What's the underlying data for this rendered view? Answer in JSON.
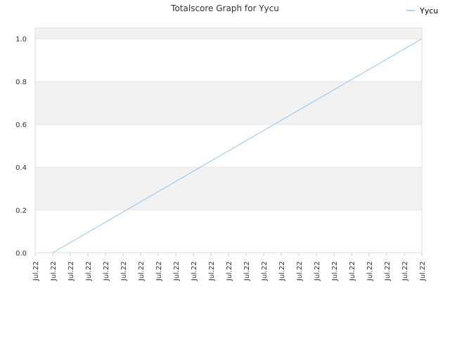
{
  "chart_data": {
    "type": "line",
    "title": "Totalscore Graph for Yycu",
    "xlabel": "",
    "ylabel": "",
    "ylim": [
      0.0,
      1.05
    ],
    "yticks": [
      "0.0",
      "0.2",
      "0.4",
      "0.6",
      "0.8",
      "1.0"
    ],
    "ytick_values": [
      0.0,
      0.2,
      0.4,
      0.6,
      0.8,
      1.0
    ],
    "x_tick_labels": [
      "Jul.22",
      "Jul.22",
      "Jul.22",
      "Jul.22",
      "Jul.22",
      "Jul.22",
      "Jul.22",
      "Jul.22",
      "Jul.22",
      "Jul.22",
      "Jul.22",
      "Jul.22",
      "Jul.22",
      "Jul.22",
      "Jul.22",
      "Jul.22",
      "Jul.22",
      "Jul.22",
      "Jul.22",
      "Jul.22",
      "Jul.22",
      "Jul.22",
      "Jul.22"
    ],
    "grid": true,
    "legend_position": "top-right",
    "series": [
      {
        "name": "Yycu",
        "color": "#90c4f0",
        "x": [
          1,
          22
        ],
        "y": [
          0.0,
          1.0
        ]
      }
    ]
  }
}
